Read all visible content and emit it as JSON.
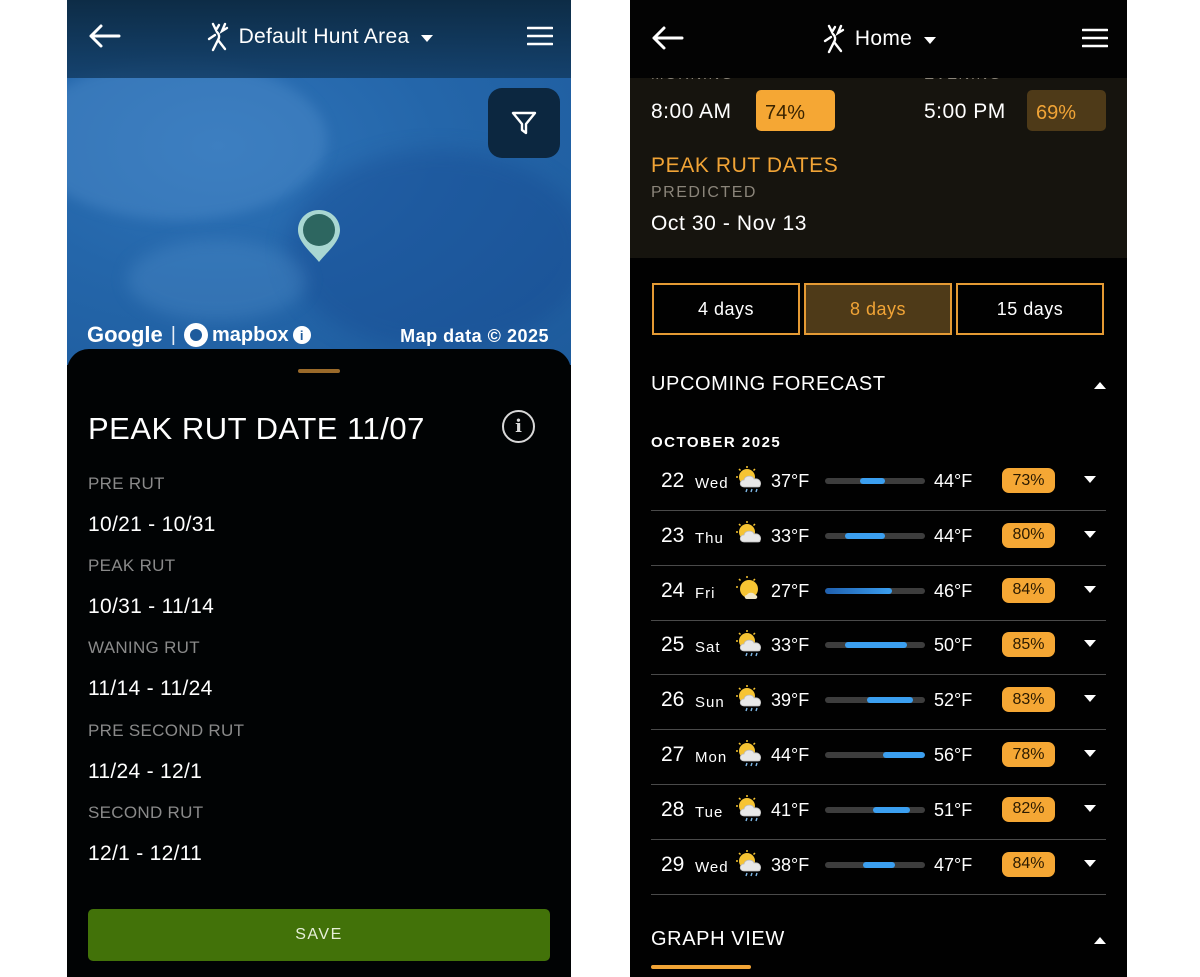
{
  "left": {
    "header": {
      "title": "Default Hunt Area"
    },
    "map": {
      "attribution_google": "Google",
      "attribution_sep": "|",
      "attribution_mapbox": "mapbox",
      "attribution_info": "i",
      "map_data": "Map data © 2025"
    },
    "sheet": {
      "title": "PEAK RUT DATE 11/07",
      "info_glyph": "i",
      "phases": [
        {
          "label": "PRE RUT",
          "range": "10/21 - 10/31"
        },
        {
          "label": "PEAK RUT",
          "range": "10/31 - 11/14"
        },
        {
          "label": "WANING RUT",
          "range": "11/14 - 11/24"
        },
        {
          "label": "PRE SECOND RUT",
          "range": "11/24 - 12/1"
        },
        {
          "label": "SECOND RUT",
          "range": "12/1 - 12/11"
        }
      ],
      "save_label": "SAVE"
    },
    "colors": {
      "save_button": "#427209",
      "map_water": "#2466aa"
    }
  },
  "right": {
    "header": {
      "title": "Home"
    },
    "activity": {
      "morning_label": "MORNING",
      "evening_label": "EVENING",
      "morning_time": "8:00 AM",
      "morning_pct": "74%",
      "evening_time": "5:00 PM",
      "evening_pct": "69%"
    },
    "peak_rut": {
      "title": "PEAK RUT DATES",
      "predicted_label": "PREDICTED",
      "range": "Oct 30 - Nov 13"
    },
    "tabs": [
      {
        "label": "4 days",
        "active": false
      },
      {
        "label": "8 days",
        "active": true
      },
      {
        "label": "15 days",
        "active": false
      }
    ],
    "forecast": {
      "title": "UPCOMING FORECAST",
      "month": "OCTOBER 2025",
      "rows": [
        {
          "day": "22",
          "dow": "Wed",
          "icon": "cloudy-rain-icon",
          "lo": "37°F",
          "hi": "44°F",
          "range_start": 0.35,
          "range_end": 0.6,
          "pct": "73%"
        },
        {
          "day": "23",
          "dow": "Thu",
          "icon": "partly-cloudy-sun-icon",
          "lo": "33°F",
          "hi": "44°F",
          "range_start": 0.2,
          "range_end": 0.6,
          "pct": "80%"
        },
        {
          "day": "24",
          "dow": "Fri",
          "icon": "sunny-cloud-icon",
          "lo": "27°F",
          "hi": "46°F",
          "range_start": 0.0,
          "range_end": 0.67,
          "pct": "84%"
        },
        {
          "day": "25",
          "dow": "Sat",
          "icon": "cloudy-rain-icon",
          "lo": "33°F",
          "hi": "50°F",
          "range_start": 0.2,
          "range_end": 0.82,
          "pct": "85%"
        },
        {
          "day": "26",
          "dow": "Sun",
          "icon": "cloudy-rain-icon",
          "lo": "39°F",
          "hi": "52°F",
          "range_start": 0.42,
          "range_end": 0.88,
          "pct": "83%"
        },
        {
          "day": "27",
          "dow": "Mon",
          "icon": "cloudy-rain-icon",
          "lo": "44°F",
          "hi": "56°F",
          "range_start": 0.58,
          "range_end": 1.0,
          "pct": "78%"
        },
        {
          "day": "28",
          "dow": "Tue",
          "icon": "cloudy-rain-icon",
          "lo": "41°F",
          "hi": "51°F",
          "range_start": 0.48,
          "range_end": 0.85,
          "pct": "82%"
        },
        {
          "day": "29",
          "dow": "Wed",
          "icon": "cloudy-rain-icon",
          "lo": "38°F",
          "hi": "47°F",
          "range_start": 0.38,
          "range_end": 0.7,
          "pct": "84%"
        }
      ]
    },
    "graph_view": {
      "title": "GRAPH VIEW"
    },
    "colors": {
      "accent": "#f1a436",
      "pct_badge": "#f5a734",
      "temp_bar": "#3b9ff0",
      "active_tab_bg": "#4e3a18"
    }
  }
}
